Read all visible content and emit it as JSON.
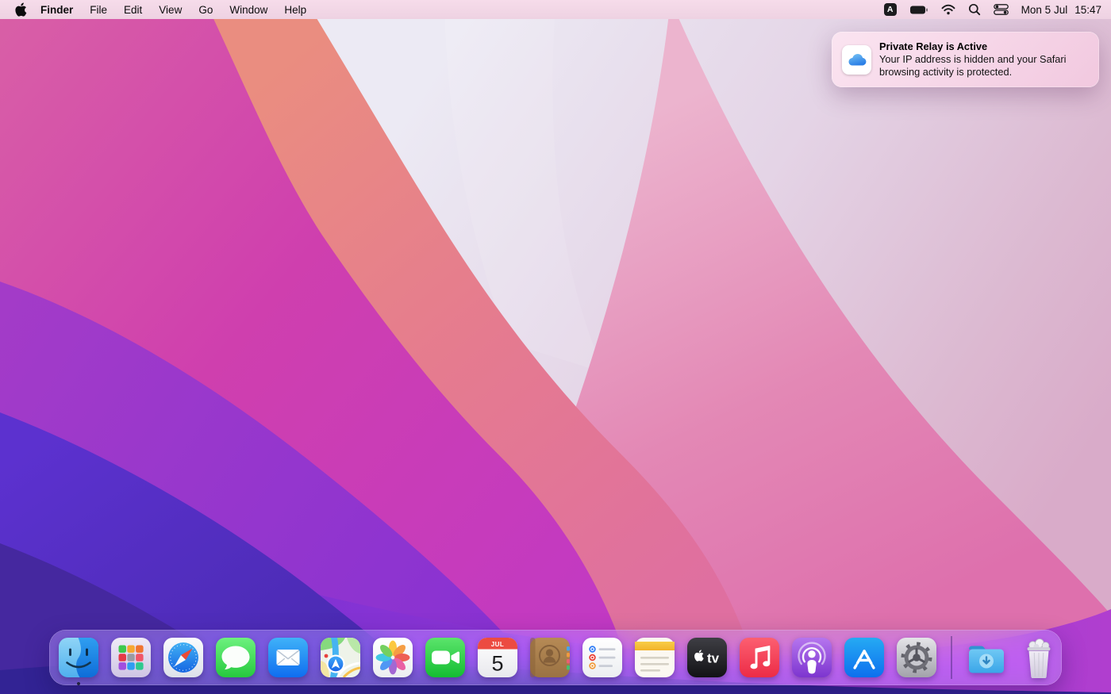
{
  "os": "macOS desktop",
  "menu_bar": {
    "app_menu": "Finder",
    "menus": [
      "File",
      "Edit",
      "View",
      "Go",
      "Window",
      "Help"
    ],
    "status": {
      "input_source": "A",
      "date": "Mon 5 Jul",
      "time": "15:47",
      "icons": [
        "input-source",
        "battery-full",
        "wifi",
        "spotlight-search",
        "control-center"
      ]
    }
  },
  "notification": {
    "app": "iCloud",
    "icon": "icloud-cloud-icon",
    "title": "Private Relay is Active",
    "body": "Your IP address is hidden and your Safari browsing activity is protected."
  },
  "dock": {
    "apps": [
      {
        "name": "Finder",
        "running": true
      },
      {
        "name": "Launchpad"
      },
      {
        "name": "Safari"
      },
      {
        "name": "Messages"
      },
      {
        "name": "Mail"
      },
      {
        "name": "Maps"
      },
      {
        "name": "Photos"
      },
      {
        "name": "FaceTime"
      },
      {
        "name": "Calendar",
        "month": "JUL",
        "day": "5"
      },
      {
        "name": "Contacts"
      },
      {
        "name": "Reminders"
      },
      {
        "name": "Notes"
      },
      {
        "name": "TV",
        "glyph_text": "tv"
      },
      {
        "name": "Music"
      },
      {
        "name": "Podcasts"
      },
      {
        "name": "App Store"
      },
      {
        "name": "System Preferences"
      }
    ],
    "others": [
      {
        "name": "Downloads"
      },
      {
        "name": "Trash",
        "state": "full"
      }
    ]
  },
  "wallpaper": {
    "name": "macOS Monterey abstract waves",
    "palette": [
      "#eceaf4",
      "#e8897e",
      "#e387b4",
      "#cf3fae",
      "#8330d4",
      "#5c31cf",
      "#322394"
    ]
  },
  "colors": {
    "menu_bar_bg": "#f4dbe9",
    "dock_tint": "rgba(176,150,228,0.46)",
    "notification_bg": "rgba(248,216,233,0.93)"
  }
}
